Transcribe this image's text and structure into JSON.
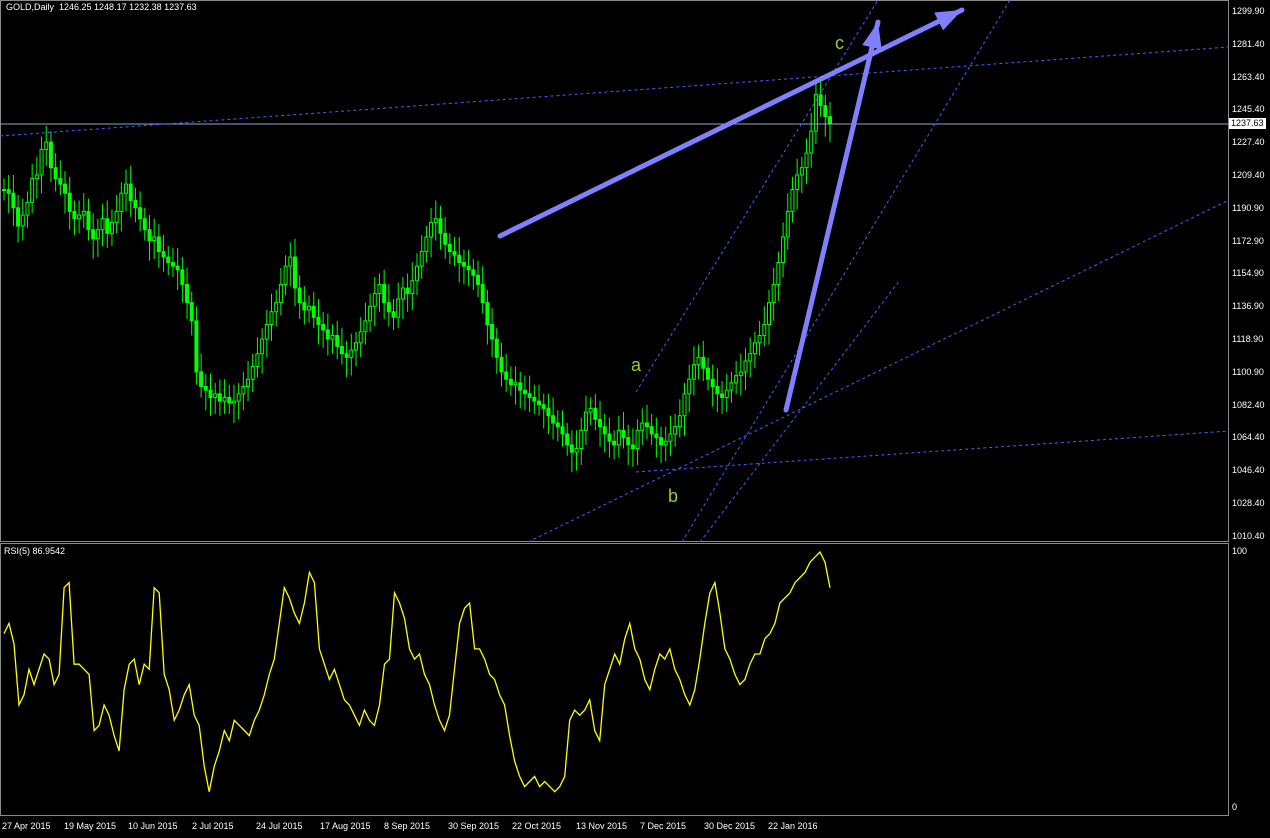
{
  "chart_header": {
    "title": "GOLD,Daily  1246.25 1248.17 1232.38 1237.63",
    "current_price": "1237.63"
  },
  "rsi_header": {
    "title": "RSI(5) 86.9542",
    "top_label": "100",
    "bottom_label": "0"
  },
  "wave_labels": {
    "a": "a",
    "b": "b",
    "c": "c"
  },
  "price_axis": [
    "1299.90",
    "1281.40",
    "1263.40",
    "1245.40",
    "1227.40",
    "1209.40",
    "1190.90",
    "1172.90",
    "1154.90",
    "1136.90",
    "1118.90",
    "1100.90",
    "1082.40",
    "1064.40",
    "1046.40",
    "1028.40",
    "1010.40"
  ],
  "time_axis": [
    "27 Apr 2015",
    "19 May 2015",
    "10 Jun 2015",
    "2 Jul 2015",
    "24 Jul 2015",
    "17 Aug 2015",
    "8 Sep 2015",
    "30 Sep 2015",
    "22 Oct 2015",
    "13 Nov 2015",
    "7 Dec 2015",
    "30 Dec 2015",
    "22 Jan 2016"
  ],
  "colors": {
    "candles": "#00ff00",
    "rsi": "#ffff00",
    "arrows": "#8080ff",
    "trendlines": "#4060ff",
    "wave_labels": "#9acd32"
  },
  "chart_data": {
    "type": "line",
    "series": [
      {
        "values": [
          1202,
          1200,
          1192,
          1182,
          1188,
          1195,
          1208,
          1210,
          1224,
          1228,
          1214,
          1208,
          1205,
          1200,
          1190,
          1186,
          1188,
          1190,
          1180,
          1175,
          1180,
          1186,
          1178,
          1184,
          1190,
          1200,
          1205,
          1196,
          1192,
          1186,
          1180,
          1174,
          1176,
          1168,
          1165,
          1162,
          1160,
          1158,
          1150,
          1140,
          1130,
          1102,
          1094,
          1092,
          1088,
          1090,
          1086,
          1088,
          1085,
          1086,
          1090,
          1094,
          1098,
          1105,
          1112,
          1120,
          1128,
          1135,
          1140,
          1150,
          1160,
          1165,
          1148,
          1140,
          1136,
          1138,
          1132,
          1128,
          1125,
          1120,
          1122,
          1116,
          1112,
          1110,
          1114,
          1118,
          1124,
          1130,
          1138,
          1145,
          1150,
          1140,
          1135,
          1132,
          1142,
          1148,
          1145,
          1152,
          1160,
          1168,
          1176,
          1184,
          1186,
          1178,
          1172,
          1168,
          1166,
          1162,
          1160,
          1158,
          1155,
          1150,
          1140,
          1128,
          1120,
          1110,
          1102,
          1098,
          1095,
          1096,
          1092,
          1090,
          1088,
          1086,
          1084,
          1082,
          1078,
          1074,
          1072,
          1068,
          1062,
          1058,
          1060,
          1070,
          1080,
          1082,
          1076,
          1072,
          1068,
          1064,
          1062,
          1070,
          1066,
          1062,
          1060,
          1070,
          1074,
          1072,
          1068,
          1066,
          1062,
          1064,
          1068,
          1072,
          1078,
          1090,
          1098,
          1106,
          1110,
          1104,
          1098,
          1094,
          1090,
          1088,
          1092,
          1096,
          1100,
          1102,
          1108,
          1112,
          1118,
          1122,
          1128,
          1140,
          1150,
          1162,
          1176,
          1190,
          1202,
          1210,
          1214,
          1222,
          1234,
          1254,
          1248,
          1242,
          1238
        ]
      }
    ],
    "rsi_values": [
      68,
      72,
      64,
      40,
      44,
      54,
      48,
      54,
      60,
      58,
      48,
      52,
      86,
      88,
      56,
      56,
      54,
      52,
      30,
      32,
      40,
      36,
      28,
      22,
      46,
      56,
      58,
      48,
      56,
      54,
      86,
      84,
      52,
      46,
      34,
      38,
      44,
      48,
      36,
      32,
      16,
      6,
      16,
      22,
      30,
      26,
      34,
      32,
      30,
      28,
      34,
      38,
      44,
      52,
      58,
      72,
      86,
      82,
      76,
      72,
      80,
      92,
      88,
      62,
      56,
      50,
      54,
      48,
      42,
      40,
      36,
      32,
      38,
      34,
      32,
      40,
      56,
      58,
      84,
      80,
      74,
      62,
      58,
      60,
      52,
      48,
      40,
      34,
      30,
      36,
      54,
      72,
      78,
      80,
      62,
      62,
      58,
      52,
      50,
      44,
      40,
      28,
      18,
      12,
      8,
      10,
      12,
      8,
      10,
      8,
      6,
      8,
      12,
      34,
      38,
      36,
      38,
      42,
      30,
      26,
      48,
      54,
      60,
      56,
      66,
      72,
      62,
      58,
      50,
      46,
      54,
      60,
      58,
      62,
      54,
      50,
      44,
      40,
      46,
      58,
      72,
      84,
      88,
      76,
      62,
      58,
      52,
      48,
      50,
      56,
      60,
      60,
      66,
      68,
      72,
      80,
      82,
      84,
      88,
      90,
      92,
      96,
      98,
      100,
      96,
      86
    ],
    "rsi_ylim": [
      0,
      100
    ]
  }
}
